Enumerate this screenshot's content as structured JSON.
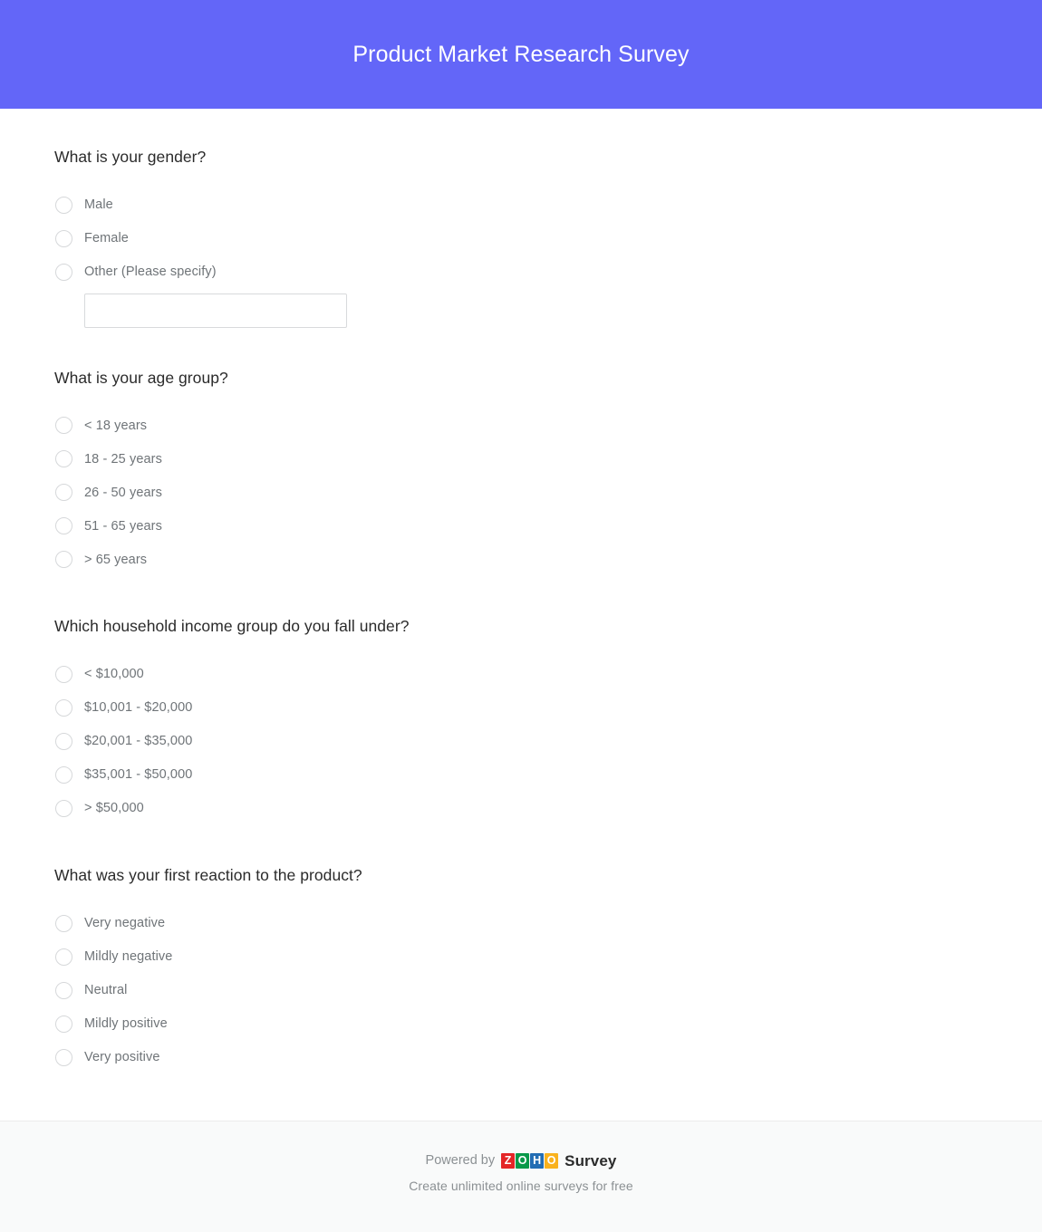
{
  "header": {
    "title": "Product Market Research Survey",
    "background_color": "#6366f8",
    "title_color": "#ffffff"
  },
  "questions": [
    {
      "id": "gender",
      "title": "What is your gender?",
      "options": [
        {
          "label": "Male"
        },
        {
          "label": "Female"
        },
        {
          "label": "Other (Please specify)"
        }
      ],
      "other_input": {
        "value": "",
        "placeholder": ""
      }
    },
    {
      "id": "age-group",
      "title": "What is your age group?",
      "options": [
        {
          "label": "< 18 years"
        },
        {
          "label": "18 - 25 years"
        },
        {
          "label": "26 - 50 years"
        },
        {
          "label": "51 - 65 years"
        },
        {
          "label": "> 65 years"
        }
      ]
    },
    {
      "id": "household-income",
      "title": "Which household income group do you fall under?",
      "options": [
        {
          "label": "< $10,000"
        },
        {
          "label": "$10,001 - $20,000"
        },
        {
          "label": "$20,001 - $35,000"
        },
        {
          "label": "$35,001 - $50,000"
        },
        {
          "label": "> $50,000"
        }
      ]
    },
    {
      "id": "first-reaction",
      "title": "What was your first reaction to the product?",
      "options": [
        {
          "label": "Very negative"
        },
        {
          "label": "Mildly negative"
        },
        {
          "label": "Neutral"
        },
        {
          "label": "Mildly positive"
        },
        {
          "label": "Very positive"
        }
      ]
    }
  ],
  "footer": {
    "powered_by": "Powered by",
    "logo": {
      "tiles": [
        {
          "letter": "Z",
          "color": "#e42527"
        },
        {
          "letter": "O",
          "color": "#089949"
        },
        {
          "letter": "H",
          "color": "#226db4"
        },
        {
          "letter": "O",
          "color": "#f9b21d"
        }
      ]
    },
    "product_word": "Survey",
    "tagline": "Create unlimited online surveys for free",
    "background_color": "#f9fafa"
  }
}
